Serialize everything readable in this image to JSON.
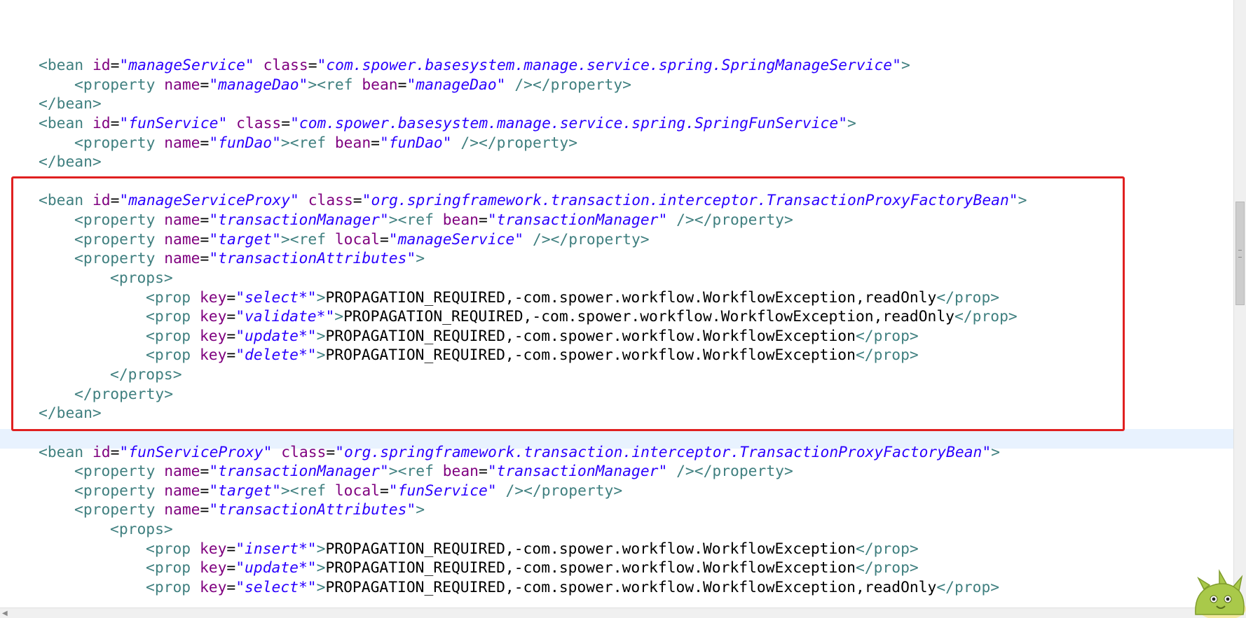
{
  "colors": {
    "tag": "#3f7f7f",
    "attribute": "#7f007f",
    "value": "#2a00ff",
    "text": "#000000",
    "highlight_border": "#e02020",
    "current_line": "#e8f2fe"
  },
  "lines": [
    {
      "indent": 0,
      "tokens": [
        [
          "tag",
          "<bean "
        ],
        [
          "attr",
          "id"
        ],
        [
          "eq",
          "="
        ],
        [
          "val",
          "\"manageService\""
        ],
        [
          "eq",
          " "
        ],
        [
          "attr",
          "class"
        ],
        [
          "eq",
          "="
        ],
        [
          "val",
          "\"com.spower.basesystem.manage.service.spring.SpringManageService\""
        ],
        [
          "tag",
          ">"
        ]
      ]
    },
    {
      "indent": 1,
      "tokens": [
        [
          "tag",
          "<property "
        ],
        [
          "attr",
          "name"
        ],
        [
          "eq",
          "="
        ],
        [
          "val",
          "\"manageDao\""
        ],
        [
          "tag",
          "><ref "
        ],
        [
          "attr",
          "bean"
        ],
        [
          "eq",
          "="
        ],
        [
          "val",
          "\"manageDao\""
        ],
        [
          "tag",
          " /></property>"
        ]
      ]
    },
    {
      "indent": 0,
      "tokens": [
        [
          "tag",
          "</bean>"
        ]
      ]
    },
    {
      "indent": 0,
      "tokens": [
        [
          "tag",
          "<bean "
        ],
        [
          "attr",
          "id"
        ],
        [
          "eq",
          "="
        ],
        [
          "val",
          "\"funService\""
        ],
        [
          "eq",
          " "
        ],
        [
          "attr",
          "class"
        ],
        [
          "eq",
          "="
        ],
        [
          "val",
          "\"com.spower.basesystem.manage.service.spring.SpringFunService\""
        ],
        [
          "tag",
          ">"
        ]
      ]
    },
    {
      "indent": 1,
      "tokens": [
        [
          "tag",
          "<property "
        ],
        [
          "attr",
          "name"
        ],
        [
          "eq",
          "="
        ],
        [
          "val",
          "\"funDao\""
        ],
        [
          "tag",
          "><ref "
        ],
        [
          "attr",
          "bean"
        ],
        [
          "eq",
          "="
        ],
        [
          "val",
          "\"funDao\""
        ],
        [
          "tag",
          " /></property>"
        ]
      ]
    },
    {
      "indent": 0,
      "tokens": [
        [
          "tag",
          "</bean>"
        ]
      ]
    },
    {
      "indent": 0,
      "tokens": []
    },
    {
      "indent": 0,
      "tokens": [
        [
          "tag",
          "<bean "
        ],
        [
          "attr",
          "id"
        ],
        [
          "eq",
          "="
        ],
        [
          "val",
          "\"manageServiceProxy\""
        ],
        [
          "eq",
          " "
        ],
        [
          "attr",
          "class"
        ],
        [
          "eq",
          "="
        ],
        [
          "val",
          "\"org.springframework.transaction.interceptor.TransactionProxyFactoryBean\""
        ],
        [
          "tag",
          ">"
        ]
      ]
    },
    {
      "indent": 1,
      "tokens": [
        [
          "tag",
          "<property "
        ],
        [
          "attr",
          "name"
        ],
        [
          "eq",
          "="
        ],
        [
          "val",
          "\"transactionManager\""
        ],
        [
          "tag",
          "><ref "
        ],
        [
          "attr",
          "bean"
        ],
        [
          "eq",
          "="
        ],
        [
          "val",
          "\"transactionManager\""
        ],
        [
          "tag",
          " /></property>"
        ]
      ]
    },
    {
      "indent": 1,
      "tokens": [
        [
          "tag",
          "<property "
        ],
        [
          "attr",
          "name"
        ],
        [
          "eq",
          "="
        ],
        [
          "val",
          "\"target\""
        ],
        [
          "tag",
          "><ref "
        ],
        [
          "attr",
          "local"
        ],
        [
          "eq",
          "="
        ],
        [
          "val",
          "\"manageService\""
        ],
        [
          "tag",
          " /></property>"
        ]
      ]
    },
    {
      "indent": 1,
      "tokens": [
        [
          "tag",
          "<property "
        ],
        [
          "attr",
          "name"
        ],
        [
          "eq",
          "="
        ],
        [
          "val",
          "\"transactionAttributes\""
        ],
        [
          "tag",
          ">"
        ]
      ]
    },
    {
      "indent": 2,
      "tokens": [
        [
          "tag",
          "<props>"
        ]
      ]
    },
    {
      "indent": 3,
      "tokens": [
        [
          "tag",
          "<prop "
        ],
        [
          "attr",
          "key"
        ],
        [
          "eq",
          "="
        ],
        [
          "val",
          "\"select*\""
        ],
        [
          "tag",
          ">"
        ],
        [
          "text",
          "PROPAGATION_REQUIRED,-com.spower.workflow.WorkflowException,readOnly"
        ],
        [
          "tag",
          "</prop>"
        ]
      ]
    },
    {
      "indent": 3,
      "tokens": [
        [
          "tag",
          "<prop "
        ],
        [
          "attr",
          "key"
        ],
        [
          "eq",
          "="
        ],
        [
          "val",
          "\"validate*\""
        ],
        [
          "tag",
          ">"
        ],
        [
          "text",
          "PROPAGATION_REQUIRED,-com.spower.workflow.WorkflowException,readOnly"
        ],
        [
          "tag",
          "</prop>"
        ]
      ]
    },
    {
      "indent": 3,
      "tokens": [
        [
          "tag",
          "<prop "
        ],
        [
          "attr",
          "key"
        ],
        [
          "eq",
          "="
        ],
        [
          "val",
          "\"update*\""
        ],
        [
          "tag",
          ">"
        ],
        [
          "text",
          "PROPAGATION_REQUIRED,-com.spower.workflow.WorkflowException"
        ],
        [
          "tag",
          "</prop>"
        ]
      ]
    },
    {
      "indent": 3,
      "tokens": [
        [
          "tag",
          "<prop "
        ],
        [
          "attr",
          "key"
        ],
        [
          "eq",
          "="
        ],
        [
          "val",
          "\"delete*\""
        ],
        [
          "tag",
          ">"
        ],
        [
          "text",
          "PROPAGATION_REQUIRED,-com.spower.workflow.WorkflowException"
        ],
        [
          "tag",
          "</prop>"
        ]
      ]
    },
    {
      "indent": 2,
      "tokens": [
        [
          "tag",
          "</props>"
        ]
      ]
    },
    {
      "indent": 1,
      "tokens": [
        [
          "tag",
          "</property>"
        ]
      ]
    },
    {
      "indent": 0,
      "tokens": [
        [
          "tag",
          "</bean>"
        ]
      ]
    },
    {
      "indent": 0,
      "tokens": []
    },
    {
      "indent": 0,
      "tokens": [
        [
          "tag",
          "<bean "
        ],
        [
          "attr",
          "id"
        ],
        [
          "eq",
          "="
        ],
        [
          "val",
          "\"funServiceProxy\""
        ],
        [
          "eq",
          " "
        ],
        [
          "attr",
          "class"
        ],
        [
          "eq",
          "="
        ],
        [
          "val",
          "\"org.springframework.transaction.interceptor.TransactionProxyFactoryBean\""
        ],
        [
          "tag",
          ">"
        ]
      ]
    },
    {
      "indent": 1,
      "tokens": [
        [
          "tag",
          "<property "
        ],
        [
          "attr",
          "name"
        ],
        [
          "eq",
          "="
        ],
        [
          "val",
          "\"transactionManager\""
        ],
        [
          "tag",
          "><ref "
        ],
        [
          "attr",
          "bean"
        ],
        [
          "eq",
          "="
        ],
        [
          "val",
          "\"transactionManager\""
        ],
        [
          "tag",
          " /></property>"
        ]
      ]
    },
    {
      "indent": 1,
      "tokens": [
        [
          "tag",
          "<property "
        ],
        [
          "attr",
          "name"
        ],
        [
          "eq",
          "="
        ],
        [
          "val",
          "\"target\""
        ],
        [
          "tag",
          "><ref "
        ],
        [
          "attr",
          "local"
        ],
        [
          "eq",
          "="
        ],
        [
          "val",
          "\"funService\""
        ],
        [
          "tag",
          " /></property>"
        ]
      ]
    },
    {
      "indent": 1,
      "tokens": [
        [
          "tag",
          "<property "
        ],
        [
          "attr",
          "name"
        ],
        [
          "eq",
          "="
        ],
        [
          "val",
          "\"transactionAttributes\""
        ],
        [
          "tag",
          ">"
        ]
      ]
    },
    {
      "indent": 2,
      "tokens": [
        [
          "tag",
          "<props>"
        ]
      ]
    },
    {
      "indent": 3,
      "tokens": [
        [
          "tag",
          "<prop "
        ],
        [
          "attr",
          "key"
        ],
        [
          "eq",
          "="
        ],
        [
          "val",
          "\"insert*\""
        ],
        [
          "tag",
          ">"
        ],
        [
          "text",
          "PROPAGATION_REQUIRED,-com.spower.workflow.WorkflowException"
        ],
        [
          "tag",
          "</prop>"
        ]
      ]
    },
    {
      "indent": 3,
      "tokens": [
        [
          "tag",
          "<prop "
        ],
        [
          "attr",
          "key"
        ],
        [
          "eq",
          "="
        ],
        [
          "val",
          "\"update*\""
        ],
        [
          "tag",
          ">"
        ],
        [
          "text",
          "PROPAGATION_REQUIRED,-com.spower.workflow.WorkflowException"
        ],
        [
          "tag",
          "</prop>"
        ]
      ]
    },
    {
      "indent": 3,
      "tokens": [
        [
          "tag",
          "<prop "
        ],
        [
          "attr",
          "key"
        ],
        [
          "eq",
          "="
        ],
        [
          "val",
          "\"select*\""
        ],
        [
          "tag",
          ">"
        ],
        [
          "text",
          "PROPAGATION_REQUIRED,-com.spower.workflow.WorkflowException,readOnly"
        ],
        [
          "tag",
          "</prop>"
        ]
      ]
    }
  ]
}
